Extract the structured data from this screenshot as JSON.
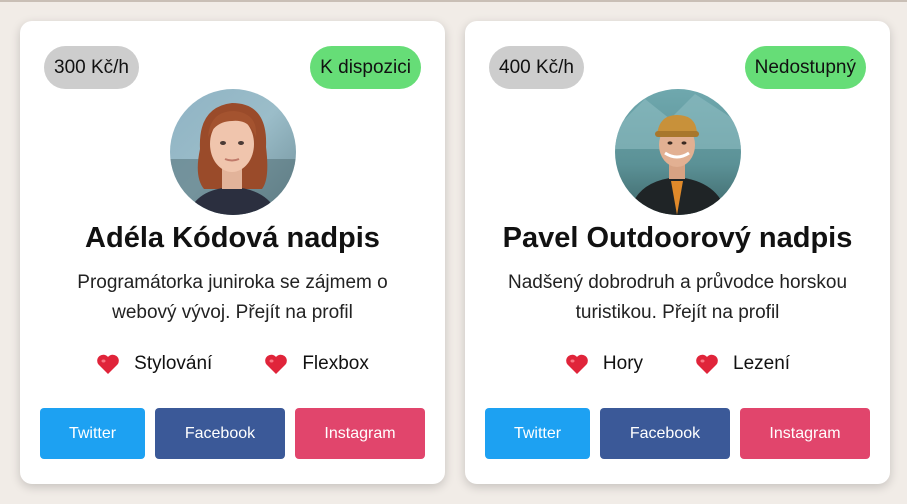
{
  "colors": {
    "price_badge": "#cdcdcd",
    "available_badge": "#66dd77",
    "twitter": "#1da1f2",
    "facebook": "#3b5998",
    "instagram": "#e1456c",
    "heart": "#e0243a"
  },
  "cards": [
    {
      "price": "300 Kč/h",
      "status": "K dispozici",
      "name": "Adéla Kódová nadpis",
      "bio": "Programátorka juniroka se zájmem o webový vývoj. Přejít na profil",
      "interests": [
        {
          "icon": "heart-icon",
          "label": "Stylování"
        },
        {
          "icon": "heart-icon",
          "label": "Flexbox"
        }
      ],
      "socials": [
        "Twitter",
        "Facebook",
        "Instagram"
      ]
    },
    {
      "price": "400 Kč/h",
      "status": "Nedostupný",
      "name": "Pavel Outdoorový nadpis",
      "bio": "Nadšený dobrodruh a průvodce horskou turistikou. Přejít na profil",
      "interests": [
        {
          "icon": "heart-icon",
          "label": "Hory"
        },
        {
          "icon": "heart-icon",
          "label": "Lezení"
        }
      ],
      "socials": [
        "Twitter",
        "Facebook",
        "Instagram"
      ]
    }
  ]
}
